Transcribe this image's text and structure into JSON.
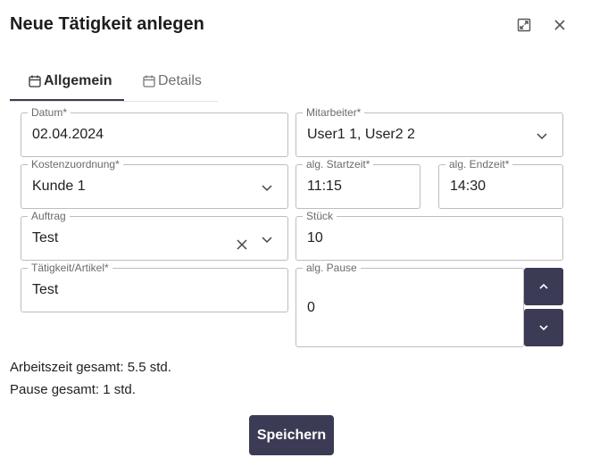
{
  "dialog": {
    "title": "Neue Tätigkeit anlegen"
  },
  "header_icons": {
    "expand": "expand-icon",
    "close": "close-icon"
  },
  "tabs": [
    {
      "label": "Allgemein",
      "icon": "calendar-icon",
      "active": true
    },
    {
      "label": "Details",
      "icon": "calendar-icon",
      "active": false
    }
  ],
  "form": {
    "datum": {
      "label": "Datum*",
      "value": "02.04.2024"
    },
    "mitarbeiter": {
      "label": "Mitarbeiter*",
      "value": "User1 1, User2 2"
    },
    "kostenzuordnung": {
      "label": "Kostenzuordnung*",
      "value": "Kunde 1"
    },
    "startzeit": {
      "label": "alg. Startzeit*",
      "value": "11:15"
    },
    "endzeit": {
      "label": "alg. Endzeit*",
      "value": "14:30"
    },
    "auftrag": {
      "label": "Auftrag",
      "value": "Test"
    },
    "stueck": {
      "label": "Stück",
      "value": "10"
    },
    "taetigkeit": {
      "label": "Tätigkeit/Artikel*",
      "value": "Test"
    },
    "pause": {
      "label": "alg. Pause",
      "value": "0"
    }
  },
  "summary": {
    "arbeitszeit": "Arbeitszeit gesamt: 5.5 std.",
    "pause": "Pause gesamt: 1 std."
  },
  "actions": {
    "save_label": "Speichern"
  },
  "colors": {
    "primary": "#3b3b55",
    "border": "#bdbdbd",
    "label": "#6b6b6b"
  }
}
